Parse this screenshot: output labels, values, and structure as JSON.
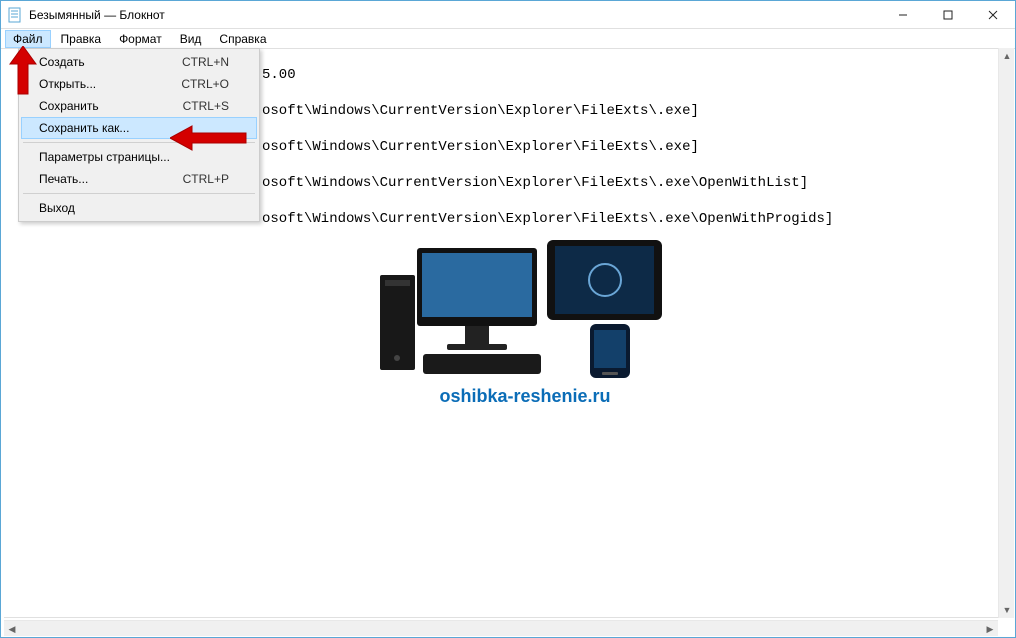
{
  "window": {
    "title": "Безымянный — Блокнот"
  },
  "menubar": {
    "file": "Файл",
    "edit": "Правка",
    "format": "Формат",
    "view": "Вид",
    "help": "Справка"
  },
  "file_menu": {
    "new": {
      "label": "Создать",
      "shortcut": "CTRL+N"
    },
    "open": {
      "label": "Открыть...",
      "shortcut": "CTRL+O"
    },
    "save": {
      "label": "Сохранить",
      "shortcut": "CTRL+S"
    },
    "save_as": {
      "label": "Сохранить как...",
      "shortcut": ""
    },
    "page_setup": {
      "label": "Параметры страницы...",
      "shortcut": ""
    },
    "print": {
      "label": "Печать...",
      "shortcut": "CTRL+P"
    },
    "exit": {
      "label": "Выход",
      "shortcut": ""
    }
  },
  "editor": {
    "partial_first": "5.00",
    "lines_dropdown_overlap": [
      "osoft\\Windows\\CurrentVersion\\Explorer\\FileExts\\.exe]",
      "osoft\\Windows\\CurrentVersion\\Explorer\\FileExts\\.exe]",
      "osoft\\Windows\\CurrentVersion\\Explorer\\FileExts\\.exe\\OpenWithList]",
      "osoft\\Windows\\CurrentVersion\\Explorer\\FileExts\\.exe\\OpenWithProgids]"
    ]
  },
  "watermark": {
    "text": "oshibka-reshenie.ru"
  }
}
